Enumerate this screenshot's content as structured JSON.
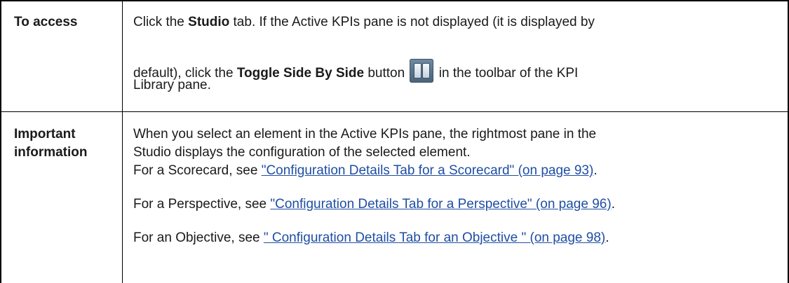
{
  "row1": {
    "label": "To access",
    "p1_a": "Click the ",
    "p1_b": "Studio",
    "p1_c": " tab. If the Active KPIs pane is not displayed (it is displayed by",
    "p2_a": "default), click the ",
    "p2_b": "Toggle Side By Side",
    "p2_c": " button",
    "p2_d": " in the toolbar of the KPI",
    "p3": "Library pane.",
    "icon": "toggle-side-by-side-icon"
  },
  "row2": {
    "label_1": "Important",
    "label_2": "information",
    "line1": "When you select an element in the Active KPIs pane, the rightmost pane in the",
    "line2": "Studio displays the configuration of the selected element.",
    "scorecard_prefix": "For a Scorecard, see ",
    "scorecard_link": "\"Configuration Details Tab for a Scorecard\" (on page 93)",
    "scorecard_suffix": ".",
    "perspective_prefix": "For a Perspective, see ",
    "perspective_link": "\"Configuration Details Tab for a Perspective\" (on page 96)",
    "perspective_suffix": ".",
    "objective_prefix": "For an Objective, see ",
    "objective_link": "\" Configuration Details Tab for an Objective \" (on page 98)",
    "objective_suffix": "."
  },
  "colors": {
    "link": "#1f4ea3",
    "border": "#000000"
  }
}
